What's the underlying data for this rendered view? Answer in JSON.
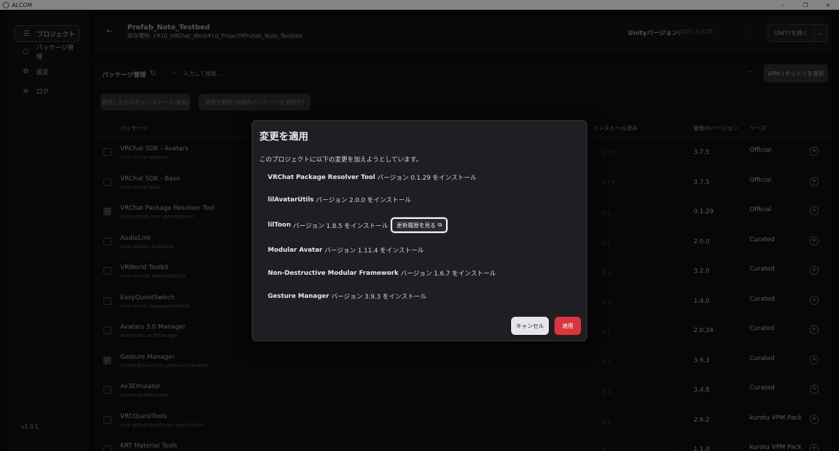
{
  "window": {
    "title": "ALCOM",
    "controls": [
      "–",
      "❐",
      "✕"
    ]
  },
  "sidebar": {
    "items": [
      {
        "label": "プロジェクト",
        "icon": "list-icon",
        "glyph": "☰"
      },
      {
        "label": "パッケージ管理",
        "icon": "package-icon",
        "glyph": "⬡"
      },
      {
        "label": "設定",
        "icon": "gear-icon",
        "glyph": "⚙"
      },
      {
        "label": "ログ",
        "icon": "log-icon",
        "glyph": "≡"
      }
    ],
    "version": "v1.0.1"
  },
  "header": {
    "project_name": "Prefab_Note_Testbed",
    "project_path": "保存場所: I:¥10_VRChat_Work¥10_Project¥Prefab_Note_Testbed",
    "unity_label": "Unityバージョン:",
    "unity_version": "2022.3.22f1",
    "open_unity": "UNITYを開く"
  },
  "main": {
    "title": "パッケージ管理",
    "search_placeholder": "入力して検索...",
    "vpm_button": "VPMリポジトリを選択",
    "install_selected": "選択したものをインストール(最新)",
    "deselect": "選択を解除 (8個のパッケージを選択中)",
    "columns": {
      "package": "パッケージ",
      "installed": "インストール済み",
      "latest": "最新のバージョン",
      "source": "ソース"
    }
  },
  "packages": [
    {
      "name": "VRChat SDK - Avatars",
      "id": "com.vrchat.avatars",
      "installed": "3.7.5",
      "latest": "3.7.5",
      "source": "Official",
      "checked": false
    },
    {
      "name": "VRChat SDK - Base",
      "id": "com.vrchat.base",
      "installed": "3.7.5",
      "latest": "3.7.5",
      "source": "Official",
      "checked": false
    },
    {
      "name": "VRChat Package Resolver Tool",
      "id": "com.vrchat.core.vpm-resolver",
      "installed": "なし",
      "latest": "0.1.29",
      "source": "Official",
      "checked": true
    },
    {
      "name": "AudioLink",
      "id": "com.llealloo.audiolink",
      "installed": "なし",
      "latest": "2.0.0",
      "source": "Curated",
      "checked": false
    },
    {
      "name": "VRWorld Toolkit",
      "id": "com.oneiros.vrworldtoolkit",
      "installed": "なし",
      "latest": "3.2.0",
      "source": "Curated",
      "checked": false
    },
    {
      "name": "EasyQuestSwitch",
      "id": "com.vrchat.easyquestswitch",
      "installed": "なし",
      "latest": "1.4.0",
      "source": "Curated",
      "checked": false
    },
    {
      "name": "Avatars 3.0 Manager",
      "id": "dev.vrlabs.av3manager",
      "installed": "なし",
      "latest": "2.0.34",
      "source": "Curated",
      "checked": false
    },
    {
      "name": "Gesture Manager",
      "id": "vrchat.blackstartx.gesture-manager",
      "installed": "なし",
      "latest": "3.9.3",
      "source": "Curated",
      "checked": true
    },
    {
      "name": "Av3Emulator",
      "id": "lyuma.av3emulator",
      "installed": "なし",
      "latest": "3.4.8",
      "source": "Curated",
      "checked": false
    },
    {
      "name": "VRCQuestTools",
      "id": "com.github.kurotu.vrc-quest-tools",
      "installed": "なし",
      "latest": "2.6.2",
      "source": "kurotu VPM Packages",
      "checked": false
    },
    {
      "name": "KRT Material Tools",
      "id": "net.kurotori.materialtools",
      "installed": "なし",
      "latest": "1.1.0",
      "source": "kurotu VPM Packages",
      "checked": false
    }
  ],
  "dialog": {
    "title": "変更を適用",
    "description": "このプロジェクトに以下の変更を加えようとしています。",
    "changes": [
      {
        "name": "VRChat Package Resolver Tool",
        "text": "バージョン 0.1.29 をインストール"
      },
      {
        "name": "lilAvatarUtils",
        "text": "バージョン 2.0.0 をインストール"
      },
      {
        "name": "lilToon",
        "text": "バージョン 1.8.5 をインストール",
        "changelog": "更新履歴を見る"
      },
      {
        "name": "Modular Avatar",
        "text": "バージョン 1.11.4 をインストール"
      },
      {
        "name": "Non-Destructive Modular Framework",
        "text": "バージョン 1.6.7 をインストール"
      },
      {
        "name": "Gesture Manager",
        "text": "バージョン 3.9.3 をインストール"
      }
    ],
    "cancel": "キャンセル",
    "apply": "適用"
  },
  "colors": {
    "apply_button": "#d9363e",
    "dialog_bg": "#1f1e23",
    "app_bg": "#0a0a0b"
  }
}
